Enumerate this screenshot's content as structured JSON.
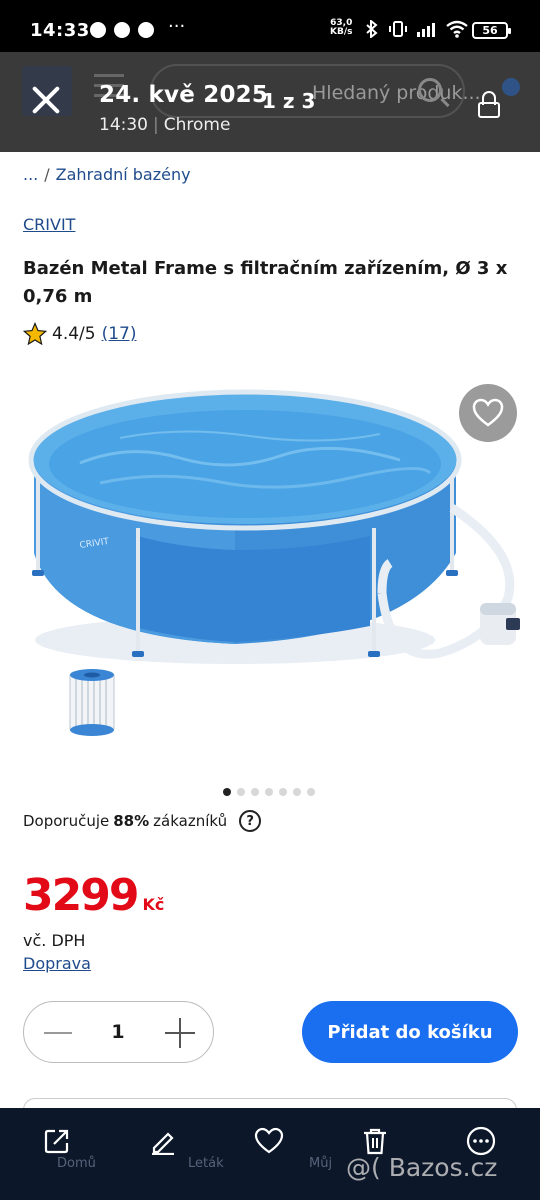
{
  "status_bar": {
    "time": "14:33",
    "more": "···",
    "net_speed_value": "63,0",
    "net_speed_unit": "KB/s",
    "battery": "56"
  },
  "viewer": {
    "date": "24. kvě 2025",
    "counter": "1 z 3",
    "time": "14:30",
    "app": "Chrome"
  },
  "background_page": {
    "search_placeholder": "Hledaný produk...",
    "nav_labels": [
      "Domů",
      "Leták",
      "Můj"
    ]
  },
  "breadcrumb": {
    "ellipsis": "...",
    "separator": "/",
    "category": "Zahradní bazény"
  },
  "product": {
    "brand": "CRIVIT",
    "title": "Bazén Metal Frame s filtračním zařízením, Ø 3 x 0,76 m",
    "rating": "4.4/5",
    "review_count": "(17)",
    "image_dots_total": 7,
    "image_dots_active": 0,
    "recommend_prefix": "Doporučuje",
    "recommend_percent": "88%",
    "recommend_suffix": "zákazníků",
    "help_glyph": "?",
    "price": "3299",
    "currency": "Kč",
    "vat_note": "vč. DPH",
    "shipping_link": "Doprava",
    "quantity": "1",
    "add_to_cart": "Přidat do košíku"
  },
  "toolbar": {
    "icons": [
      "share-icon",
      "edit-icon",
      "favorite-icon",
      "delete-icon",
      "more-icon"
    ]
  },
  "watermark": "@( Bazos.cz",
  "colors": {
    "price_red": "#e30a18",
    "link_blue": "#1f4b8c",
    "button_blue": "#1a6ef0",
    "toolbar_bg": "#0c1729",
    "header_bg": "#3a3a3a"
  }
}
